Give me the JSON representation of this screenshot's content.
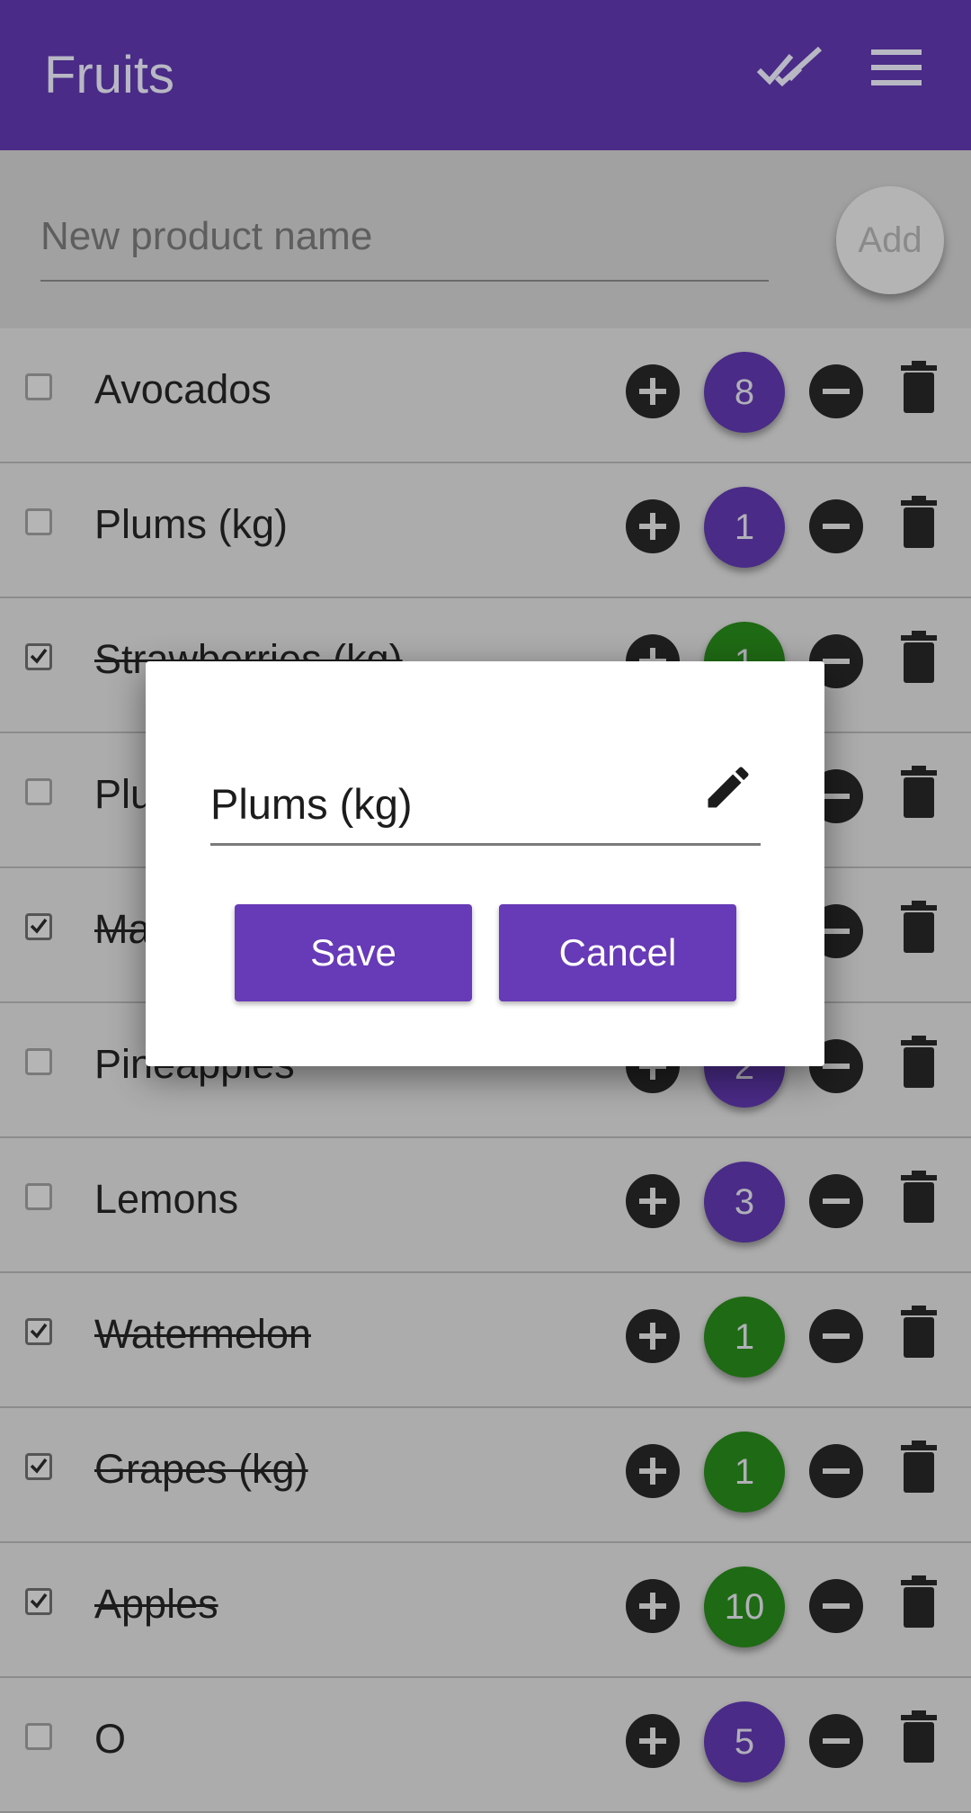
{
  "appbar": {
    "title": "Fruits",
    "icons": [
      "done-all-icon",
      "menu-icon"
    ],
    "color": "#4a2b87"
  },
  "add_bar": {
    "placeholder": "New product name",
    "add_label": "Add"
  },
  "items": [
    {
      "name": "Avocados",
      "qty": "8",
      "checked": false
    },
    {
      "name": "Plums (kg)",
      "qty": "1",
      "checked": false
    },
    {
      "name": "Strawberries (kg)",
      "qty": "1",
      "checked": true
    },
    {
      "name": "Plu",
      "qty": "",
      "checked": false
    },
    {
      "name": "Ma",
      "qty": "",
      "checked": true
    },
    {
      "name": "Pineapples",
      "qty": "2",
      "checked": false
    },
    {
      "name": "Lemons",
      "qty": "3",
      "checked": false
    },
    {
      "name": "Watermelon",
      "qty": "1",
      "checked": true
    },
    {
      "name": "Grapes (kg)",
      "qty": "1",
      "checked": true
    },
    {
      "name": "Apples",
      "qty": "10",
      "checked": true
    },
    {
      "name": "O",
      "qty": "5",
      "checked": false
    }
  ],
  "colors": {
    "pending_qty": "#4a2b87",
    "done_qty": "#1f6a14",
    "button": "#673ab7"
  },
  "dialog": {
    "value": "Plums (kg)",
    "save_label": "Save",
    "cancel_label": "Cancel"
  }
}
